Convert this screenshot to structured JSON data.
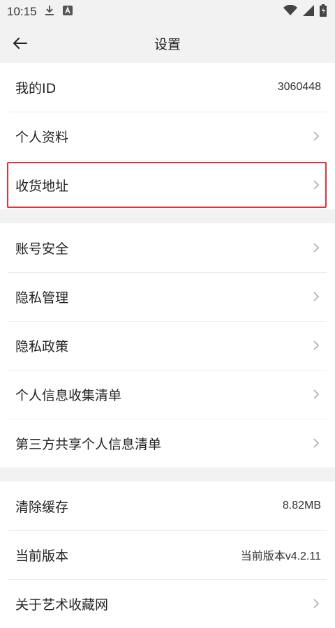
{
  "status_bar": {
    "time": "10:15",
    "icons": [
      "download-icon",
      "accessibility-a-icon",
      "wifi-icon",
      "signal-icon",
      "battery-charging-icon"
    ]
  },
  "header": {
    "title": "设置",
    "back_icon": "arrow-left-icon"
  },
  "groups": [
    {
      "items": [
        {
          "label": "我的ID",
          "value": "3060448"
        },
        {
          "label": "个人资料"
        },
        {
          "label": "收货地址",
          "highlighted": true
        }
      ]
    },
    {
      "items": [
        {
          "label": "账号安全"
        },
        {
          "label": "隐私管理"
        },
        {
          "label": "隐私政策"
        },
        {
          "label": "个人信息收集清单"
        },
        {
          "label": "第三方共享个人信息清单"
        }
      ]
    },
    {
      "items": [
        {
          "label": "清除缓存",
          "value": "8.82MB"
        },
        {
          "label": "当前版本",
          "value": "当前版本v4.2.11"
        },
        {
          "label": "关于艺术收藏网"
        }
      ]
    }
  ],
  "colors": {
    "background": "#f2f2f2",
    "card": "#ffffff",
    "highlight_border": "#e0323c",
    "chevron": "#b3b3b3"
  }
}
